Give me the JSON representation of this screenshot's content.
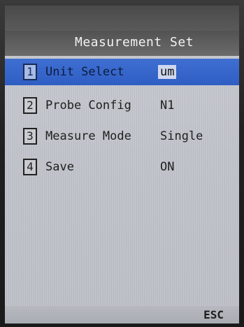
{
  "header": {
    "title": "Measurement Set"
  },
  "menu": {
    "items": [
      {
        "number": "1",
        "label": "Unit Select",
        "value": "um"
      },
      {
        "number": "2",
        "label": "Probe Config",
        "value": "N1"
      },
      {
        "number": "3",
        "label": "Measure Mode",
        "value": "Single"
      },
      {
        "number": "4",
        "label": "Save",
        "value": "ON"
      }
    ],
    "selected_index": 0
  },
  "footer": {
    "esc_label": "ESC"
  },
  "colors": {
    "highlight": "#2e5ec4",
    "screen_bg": "#c4c7ce",
    "text": "#202020"
  }
}
